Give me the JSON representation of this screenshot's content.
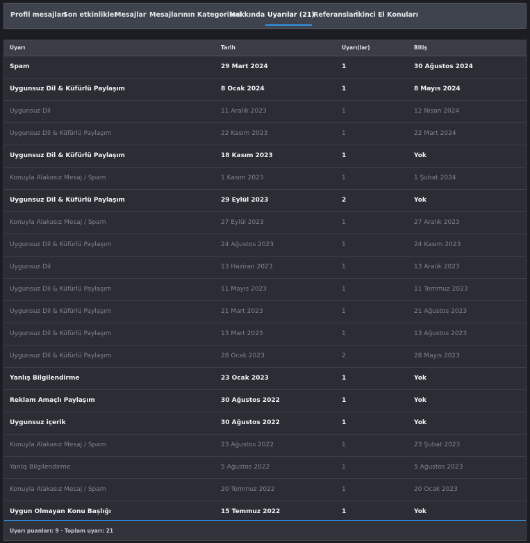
{
  "tabs": [
    {
      "label": "Profil mesajları",
      "active": false
    },
    {
      "label": "Son etkinlikler",
      "active": false
    },
    {
      "label": "Mesajlar",
      "active": false
    },
    {
      "label": "Mesajlarının Kategorileri",
      "active": false
    },
    {
      "label": "Hakkında",
      "active": false
    },
    {
      "label": "Uyarılar (21)",
      "active": true
    },
    {
      "label": "Referanslar",
      "active": false
    },
    {
      "label": "İkinci El Konuları",
      "active": false
    }
  ],
  "table": {
    "columns": [
      "Uyarı",
      "Tarih",
      "Uyarı(lar)",
      "Bitiş"
    ],
    "rows": [
      {
        "warning": "Spam",
        "date": "29 Mart 2024",
        "points": "1",
        "expires": "30 Ağustos 2024",
        "status": "active"
      },
      {
        "warning": "Uygunsuz Dil & Küfürlü Paylaşım",
        "date": "8 Ocak 2024",
        "points": "1",
        "expires": "8 Mayıs 2024",
        "status": "active"
      },
      {
        "warning": "Uygunsuz Dil",
        "date": "11 Aralık 2023",
        "points": "1",
        "expires": "12 Nisan 2024",
        "status": "expired"
      },
      {
        "warning": "Uygunsuz Dil & Küfürlü Paylaşım",
        "date": "22 Kasım 2023",
        "points": "1",
        "expires": "22 Mart 2024",
        "status": "expired"
      },
      {
        "warning": "Uygunsuz Dil & Küfürlü Paylaşım",
        "date": "18 Kasım 2023",
        "points": "1",
        "expires": "Yok",
        "status": "active"
      },
      {
        "warning": "Konuyla Alakasız Mesaj / Spam",
        "date": "1 Kasım 2023",
        "points": "1",
        "expires": "1 Şubat 2024",
        "status": "expired"
      },
      {
        "warning": "Uygunsuz Dil & Küfürlü Paylaşım",
        "date": "29 Eylül 2023",
        "points": "2",
        "expires": "Yok",
        "status": "active"
      },
      {
        "warning": "Konuyla Alakasız Mesaj / Spam",
        "date": "27 Eylül 2023",
        "points": "1",
        "expires": "27 Aralık 2023",
        "status": "expired"
      },
      {
        "warning": "Uygunsuz Dil & Küfürlü Paylaşım",
        "date": "24 Ağustos 2023",
        "points": "1",
        "expires": "24 Kasım 2023",
        "status": "expired"
      },
      {
        "warning": "Uygunsuz Dil",
        "date": "13 Haziran 2023",
        "points": "1",
        "expires": "13 Aralık 2023",
        "status": "expired"
      },
      {
        "warning": "Uygunsuz Dil & Küfürlü Paylaşım",
        "date": "11 Mayıs 2023",
        "points": "1",
        "expires": "11 Temmuz 2023",
        "status": "expired"
      },
      {
        "warning": "Uygunsuz Dil & Küfürlü Paylaşım",
        "date": "21 Mart 2023",
        "points": "1",
        "expires": "21 Ağustos 2023",
        "status": "expired"
      },
      {
        "warning": "Uygunsuz Dil & Küfürlü Paylaşım",
        "date": "13 Mart 2023",
        "points": "1",
        "expires": "13 Ağustos 2023",
        "status": "expired"
      },
      {
        "warning": "Uygunsuz Dil & Küfürlü Paylaşım",
        "date": "28 Ocak 2023",
        "points": "2",
        "expires": "28 Mayıs 2023",
        "status": "expired"
      },
      {
        "warning": "Yanlış Bilgilendirme",
        "date": "23 Ocak 2023",
        "points": "1",
        "expires": "Yok",
        "status": "active"
      },
      {
        "warning": "Reklam Amaçlı Paylaşım",
        "date": "30 Ağustos 2022",
        "points": "1",
        "expires": "Yok",
        "status": "active"
      },
      {
        "warning": "Uygunsuz içerik",
        "date": "30 Ağustos 2022",
        "points": "1",
        "expires": "Yok",
        "status": "active"
      },
      {
        "warning": "Konuyla Alakasız Mesaj / Spam",
        "date": "23 Ağustos 2022",
        "points": "1",
        "expires": "23 Şubat 2023",
        "status": "expired"
      },
      {
        "warning": "Yanlış Bilgilendirme",
        "date": "5 Ağustos 2022",
        "points": "1",
        "expires": "5 Ağustos 2023",
        "status": "expired"
      },
      {
        "warning": "Konuyla Alakasız Mesaj / Spam",
        "date": "20 Temmuz 2022",
        "points": "1",
        "expires": "20 Ocak 2023",
        "status": "expired"
      },
      {
        "warning": "Uygun Olmayan Konu Başlığı",
        "date": "15 Temmuz 2022",
        "points": "1",
        "expires": "Yok",
        "status": "active"
      }
    ]
  },
  "footer": {
    "summary": "Uyarı puanları: 9 · Toplam uyarı: 21"
  },
  "colors": {
    "accent": "#2f93e6",
    "active_text": "#f2f3f5",
    "expired_text": "#7f848e"
  }
}
